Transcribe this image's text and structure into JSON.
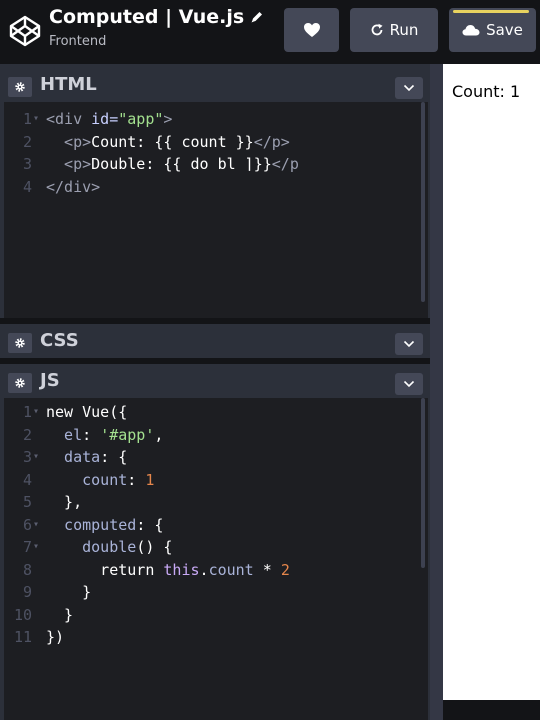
{
  "header": {
    "title": "Computed | Vue.js",
    "subtitle": "Frontend",
    "run_label": "Run",
    "save_label": "Save"
  },
  "panels": {
    "html": {
      "title": "HTML",
      "lines": [
        {
          "num": "1",
          "fold": "▾",
          "parts": [
            [
              "t-tag",
              "<div "
            ],
            [
              "t-attr",
              "id="
            ],
            [
              "t-str",
              "\"app\""
            ],
            [
              "t-tag",
              ">"
            ]
          ]
        },
        {
          "num": "2",
          "fold": "",
          "parts": [
            [
              "t-tag",
              "  <p>"
            ],
            [
              "t-kw",
              "Count: {{ count }}"
            ],
            [
              "t-tag",
              "</p>"
            ]
          ]
        },
        {
          "num": "3",
          "fold": "",
          "parts": [
            [
              "t-tag",
              "  <p>"
            ],
            [
              "t-kw",
              "Double: {{ do bl ⌉}}"
            ],
            [
              "t-tag",
              "</p"
            ]
          ]
        },
        {
          "num": "4",
          "fold": "",
          "parts": [
            [
              "t-tag",
              "</div>"
            ]
          ]
        }
      ]
    },
    "css": {
      "title": "CSS"
    },
    "js": {
      "title": "JS",
      "lines": [
        {
          "num": "1",
          "fold": "▾",
          "parts": [
            [
              "t-kw",
              "new Vue({"
            ]
          ]
        },
        {
          "num": "2",
          "fold": "",
          "parts": [
            [
              "t-prop",
              "  el"
            ],
            [
              "t-kw",
              ": "
            ],
            [
              "t-str",
              "'#app'"
            ],
            [
              "t-kw",
              ","
            ]
          ]
        },
        {
          "num": "3",
          "fold": "▾",
          "parts": [
            [
              "t-prop",
              "  data"
            ],
            [
              "t-kw",
              ": {"
            ]
          ]
        },
        {
          "num": "4",
          "fold": "",
          "parts": [
            [
              "t-prop",
              "    count"
            ],
            [
              "t-kw",
              ": "
            ],
            [
              "t-num",
              "1"
            ]
          ]
        },
        {
          "num": "5",
          "fold": "",
          "parts": [
            [
              "t-kw",
              "  },"
            ]
          ]
        },
        {
          "num": "6",
          "fold": "▾",
          "parts": [
            [
              "t-prop",
              "  computed"
            ],
            [
              "t-kw",
              ": {"
            ]
          ]
        },
        {
          "num": "7",
          "fold": "▾",
          "parts": [
            [
              "t-prop",
              "    double"
            ],
            [
              "t-kw",
              "() {"
            ]
          ]
        },
        {
          "num": "8",
          "fold": "",
          "parts": [
            [
              "t-kw",
              "      return "
            ],
            [
              "t-this",
              "this"
            ],
            [
              "t-kw",
              "."
            ],
            [
              "t-prop",
              "count"
            ],
            [
              "t-kw",
              " * "
            ],
            [
              "t-num",
              "2"
            ]
          ]
        },
        {
          "num": "9",
          "fold": "",
          "parts": [
            [
              "t-kw",
              "    }"
            ]
          ]
        },
        {
          "num": "10",
          "fold": "",
          "parts": [
            [
              "t-kw",
              "  }"
            ]
          ]
        },
        {
          "num": "11",
          "fold": "",
          "parts": [
            [
              "t-kw",
              "})"
            ]
          ]
        }
      ]
    }
  },
  "preview": {
    "text": "Count: 1"
  },
  "colors": {
    "header_bg": "#131417",
    "editor_bg": "#1d1e22",
    "button_bg": "#444857",
    "save_accent": "#e8d35f"
  }
}
